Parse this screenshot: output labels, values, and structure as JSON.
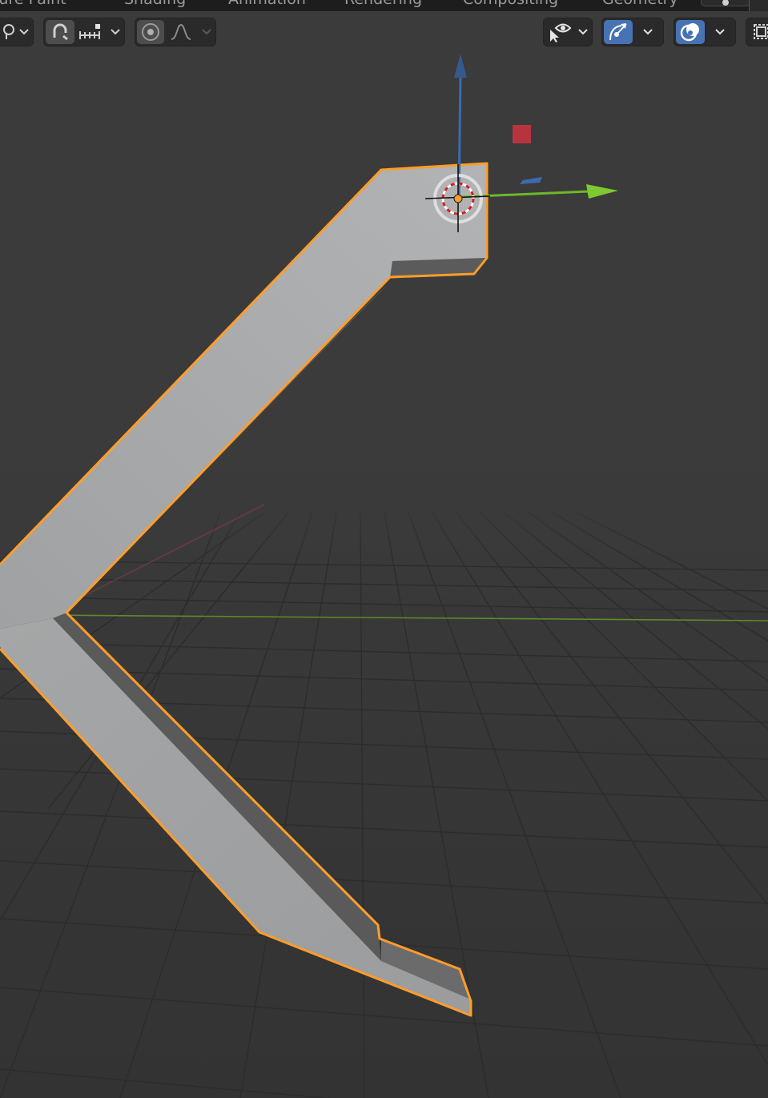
{
  "workspace_tabs": [
    {
      "label": "Texture Paint"
    },
    {
      "label": "Shading"
    },
    {
      "label": "Animation"
    },
    {
      "label": "Rendering"
    },
    {
      "label": "Compositing"
    },
    {
      "label": "Geometry"
    }
  ],
  "header": {
    "pivot_icon": "pivot-point-icon",
    "snap_icon": "snap-magnet-icon",
    "snap_target_icon": "snap-increment-icon",
    "proportional_icon": "proportional-edit-icon",
    "falloff_icon": "falloff-curve-icon",
    "visibility_icon": "object-visibility-icon",
    "gizmo_icon": "gizmo-toggle-icon",
    "overlay_icon": "overlay-toggle-icon",
    "xray_icon": "xray-toggle-icon"
  },
  "colors": {
    "selection_outline": "#ff9d2b",
    "axis_x": "#b7343f",
    "axis_y": "#6db82a",
    "axis_z": "#3c6bb0",
    "active_button": "#4772b3",
    "mesh_surface": "#a6a8aa",
    "viewport_bg": "#3a3a3a"
  }
}
